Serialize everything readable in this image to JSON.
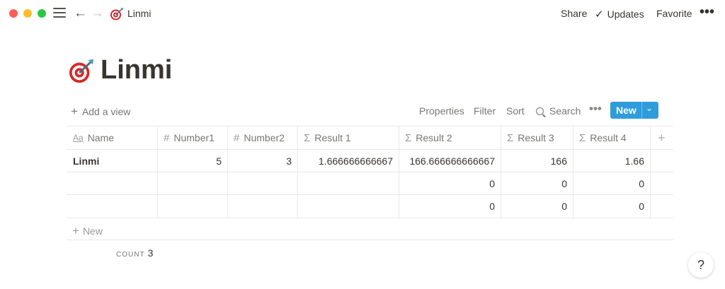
{
  "window": {
    "controls": [
      "close",
      "minimize",
      "zoom"
    ]
  },
  "topbar": {
    "breadcrumb_label": "Linmi",
    "breadcrumb_icon": "dart-target-icon",
    "share_label": "Share",
    "updates_label": "Updates",
    "favorite_label": "Favorite",
    "more_label": "•••"
  },
  "page": {
    "title": "Linmi",
    "icon": "dart-target-icon"
  },
  "toolbar": {
    "add_view_label": "Add a view",
    "properties_label": "Properties",
    "filter_label": "Filter",
    "sort_label": "Sort",
    "search_label": "Search",
    "more_label": "•••",
    "new_label": "New"
  },
  "table": {
    "columns": [
      {
        "label": "Name",
        "icon": "Aa"
      },
      {
        "label": "Number1",
        "icon": "#"
      },
      {
        "label": "Number2",
        "icon": "#"
      },
      {
        "label": "Result 1",
        "icon": "Σ"
      },
      {
        "label": "Result 2",
        "icon": "Σ"
      },
      {
        "label": "Result 3",
        "icon": "Σ"
      },
      {
        "label": "Result 4",
        "icon": "Σ"
      }
    ],
    "rows": [
      [
        "Linmi",
        "5",
        "3",
        "1.666666666667",
        "166.666666666667",
        "166",
        "1.66"
      ],
      [
        "",
        "",
        "",
        "",
        "0",
        "0",
        "0"
      ],
      [
        "",
        "",
        "",
        "",
        "0",
        "0",
        "0"
      ]
    ],
    "add_column_label": "+",
    "new_row_label": "New"
  },
  "footer": {
    "count_label": "COUNT",
    "count_value": "3"
  },
  "help_label": "?",
  "colors": {
    "accent": "#2f9cdb",
    "text": "#37352f",
    "muted": "#787774"
  }
}
